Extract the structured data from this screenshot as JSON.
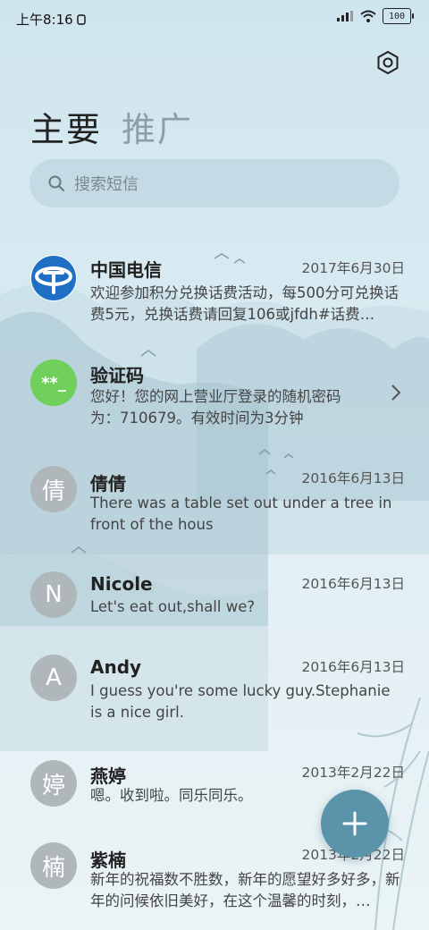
{
  "status_bar": {
    "time": "上午8:16",
    "battery": "100",
    "icons": [
      "phone-icon",
      "signal-icon",
      "wifi-icon",
      "battery-icon"
    ]
  },
  "header": {
    "tabs": [
      {
        "label": "主要",
        "active": true
      },
      {
        "label": "推广",
        "active": false
      }
    ]
  },
  "search": {
    "placeholder": "搜索短信"
  },
  "conversations": [
    {
      "name": "中国电信",
      "date": "2017年6月30日",
      "preview": "欢迎参加积分兑换话费活动，每500分可兑换话费5元，兑换话费请回复106或jfdh#话费…",
      "avatar": "china-telecom-logo"
    },
    {
      "name": "验证码",
      "date": "",
      "preview": "您好！您的网上营业厅登录的随机密码为：710679。有效时间为3分钟",
      "avatar_text": "**_",
      "avatar_color": "#6fcf5a"
    },
    {
      "name": "倩倩",
      "date": "2016年6月13日",
      "preview": "There was a table set out under a tree in front of the hous",
      "avatar_text": "倩"
    },
    {
      "name": "Nicole",
      "date": "2016年6月13日",
      "preview": "Let's eat out,shall we?",
      "avatar_text": "N"
    },
    {
      "name": "Andy",
      "date": "2016年6月13日",
      "preview": "I guess you're some lucky guy.Stephanie is a nice girl.",
      "avatar_text": "A"
    },
    {
      "name": "燕婷",
      "date": "2013年2月22日",
      "preview": "嗯。收到啦。同乐同乐。",
      "avatar_text": "婷"
    },
    {
      "name": "紫楠",
      "date": "2013年2月22日",
      "preview": "新年的祝福数不胜数，新年的愿望好多好多，新年的问候依旧美好，在这个温馨的时刻，…",
      "avatar_text": "楠"
    }
  ],
  "fab": {
    "icon": "plus-icon"
  },
  "colors": {
    "accent": "#5b93ab",
    "code_avatar": "#6fcf5a",
    "avatar_gray": "#b0b7ba",
    "telecom_blue": "#1f6fc4"
  }
}
